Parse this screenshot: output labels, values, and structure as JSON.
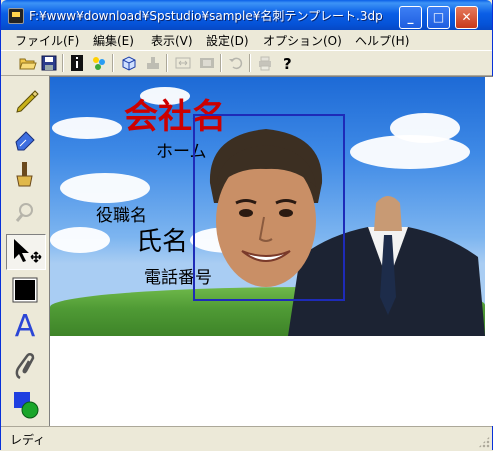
{
  "window": {
    "title": "F:¥www¥download¥Spstudio¥sample¥名刺テンプレート.3dp"
  },
  "title_buttons": {
    "minimize": "_",
    "maximize": "□",
    "close": "✕"
  },
  "menu": {
    "items": [
      {
        "label": "ファイル(F)"
      },
      {
        "label": "編集(E)"
      },
      {
        "label": "表示(V)"
      },
      {
        "label": "設定(D)"
      },
      {
        "label": "オプション(O)"
      },
      {
        "label": "ヘルプ(H)"
      }
    ]
  },
  "toolbar": {
    "icons": [
      "open-folder-icon",
      "save-icon",
      "info-icon",
      "sparkle-icon",
      "cube-icon",
      "stamp-icon",
      "resize-icon",
      "film-icon",
      "undo-icon",
      "print-icon",
      "help-icon"
    ]
  },
  "palette": {
    "tools": [
      "pencil-icon",
      "eraser-icon",
      "brush-icon",
      "magnify-icon",
      "move-arrow-icon",
      "color-swatch-icon",
      "text-tool-icon",
      "clip-icon",
      "shapes-icon"
    ],
    "text_tool_glyph": "A",
    "swatch_color": "#000000"
  },
  "card": {
    "company": "会社名",
    "home": "ホーム",
    "role": "役職名",
    "name": "氏名",
    "phone": "電話番号",
    "selection_color": "#1e2bb8",
    "company_color": "#cc0000"
  },
  "status": {
    "text": "レディ"
  }
}
